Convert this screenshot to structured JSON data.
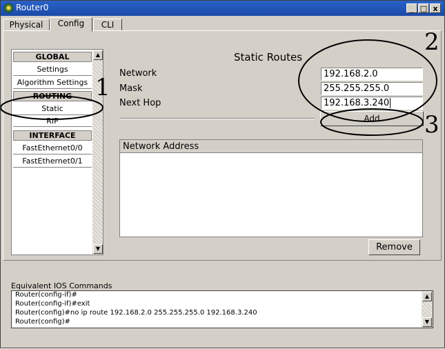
{
  "window": {
    "title": "Router0",
    "controls": {
      "minimize": "_",
      "maximize": "□",
      "close": "x"
    }
  },
  "tabs": [
    {
      "label": "Physical"
    },
    {
      "label": "Config",
      "active": true
    },
    {
      "label": "CLI"
    }
  ],
  "sidebar": {
    "global_header": "GLOBAL",
    "global_items": [
      "Settings",
      "Algorithm Settings"
    ],
    "routing_header": "ROUTING",
    "routing_items": [
      "Static",
      "RIP"
    ],
    "interface_header": "INTERFACE",
    "interface_items": [
      "FastEthernet0/0",
      "FastEthernet0/1"
    ]
  },
  "static_routes": {
    "title": "Static Routes",
    "network_label": "Network",
    "network_value": "192.168.2.0",
    "mask_label": "Mask",
    "mask_value": "255.255.255.0",
    "nexthop_label": "Next Hop",
    "nexthop_value": "192.168.3.240",
    "add_label": "Add",
    "table_header": "Network Address",
    "remove_label": "Remove"
  },
  "ios": {
    "label": "Equivalent IOS Commands",
    "lines": [
      "Router(config-if)#",
      "Router(config-if)#exit",
      "Router(config)#no ip route 192.168.2.0 255.255.255.0 192.168.3.240",
      "Router(config)#"
    ]
  },
  "annotations": [
    "1",
    "2",
    "3"
  ],
  "icons": {
    "app": "router-app-icon",
    "scroll_up": "scroll-up-arrow-icon",
    "scroll_down": "scroll-down-arrow-icon"
  }
}
